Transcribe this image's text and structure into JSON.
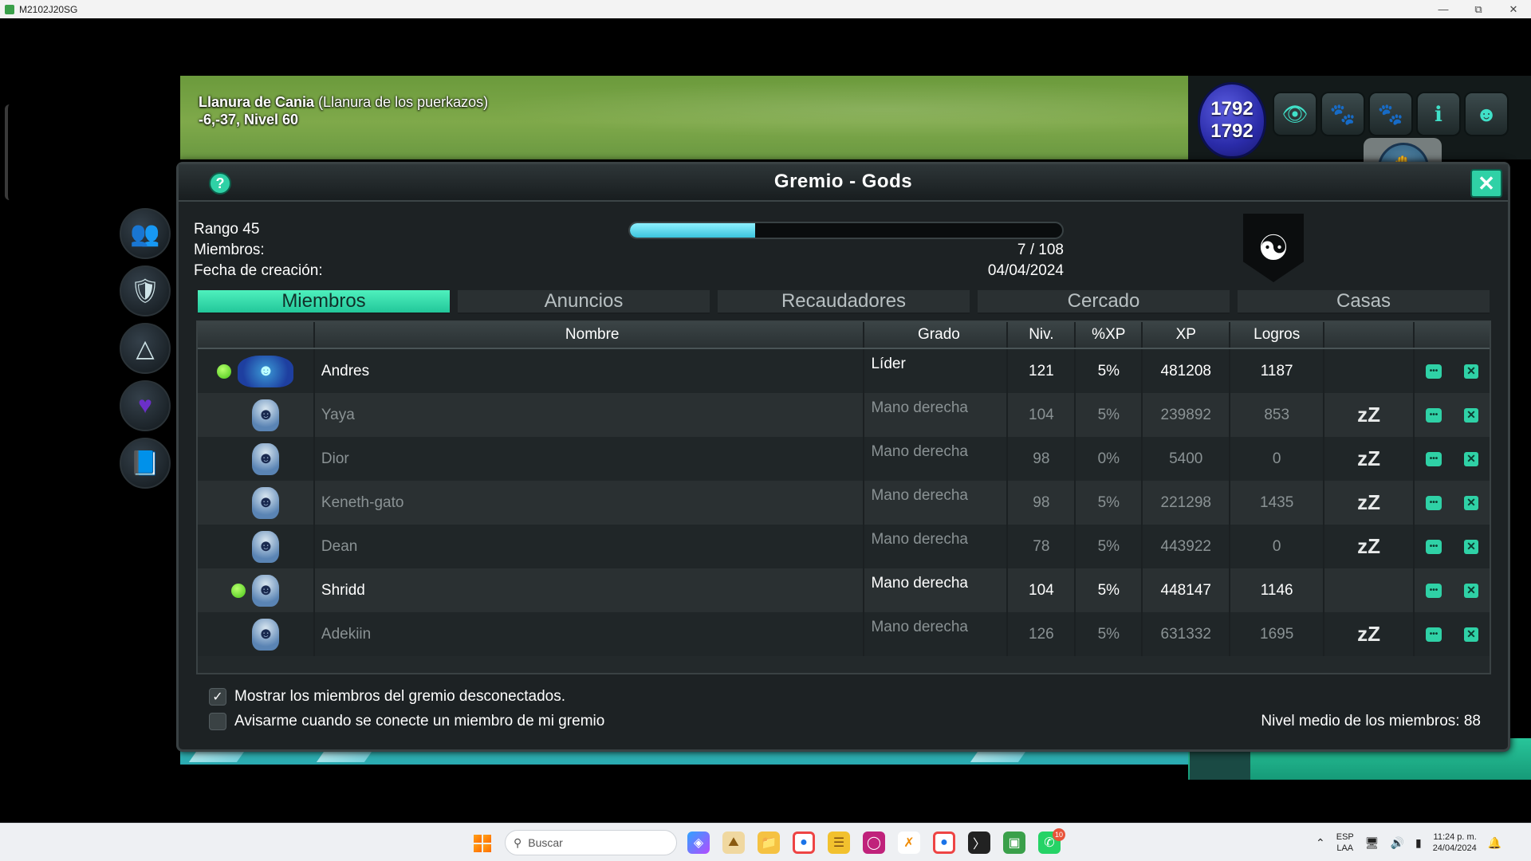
{
  "window": {
    "title": "M2102J20SG"
  },
  "location": {
    "name": "Llanura de Cania",
    "subzone": "(Llanura de los puerkazos)",
    "coords": "-6,-37, Nivel 60"
  },
  "hud": {
    "hp_current": "1792",
    "hp_max": "1792"
  },
  "dialog": {
    "title": "Gremio - Gods",
    "rank_label": "Rango 45",
    "members_label": "Miembros:",
    "members_value": "7 / 108",
    "created_label": "Fecha de creación:",
    "created_value": "04/04/2024",
    "xp_progress": 0.29
  },
  "tabs": [
    "Miembros",
    "Anuncios",
    "Recaudadores",
    "Cercado",
    "Casas"
  ],
  "active_tab": "Miembros",
  "table": {
    "headers": {
      "name": "Nombre",
      "grade": "Grado",
      "level": "Niv.",
      "xp_pct": "%XP",
      "xp": "XP",
      "achievements": "Logros"
    },
    "rows": [
      {
        "name": "Andres",
        "grade": "Líder",
        "level": "121",
        "xp_pct": "5%",
        "xp": "481208",
        "achievements": "1187",
        "online": true,
        "away": ""
      },
      {
        "name": "Yaya",
        "grade": "Mano derecha",
        "level": "104",
        "xp_pct": "5%",
        "xp": "239892",
        "achievements": "853",
        "online": false,
        "away": "zZ"
      },
      {
        "name": "Dior",
        "grade": "Mano derecha",
        "level": "98",
        "xp_pct": "0%",
        "xp": "5400",
        "achievements": "0",
        "online": false,
        "away": "zZ"
      },
      {
        "name": "Keneth-gato",
        "grade": "Mano derecha",
        "level": "98",
        "xp_pct": "5%",
        "xp": "221298",
        "achievements": "1435",
        "online": false,
        "away": "zZ"
      },
      {
        "name": "Dean",
        "grade": "Mano derecha",
        "level": "78",
        "xp_pct": "5%",
        "xp": "443922",
        "achievements": "0",
        "online": false,
        "away": "zZ"
      },
      {
        "name": "Shridd",
        "grade": "Mano derecha",
        "level": "104",
        "xp_pct": "5%",
        "xp": "448147",
        "achievements": "1146",
        "online": true,
        "away": ""
      },
      {
        "name": "Adekiin",
        "grade": "Mano derecha",
        "level": "126",
        "xp_pct": "5%",
        "xp": "631332",
        "achievements": "1695",
        "online": false,
        "away": "zZ"
      }
    ]
  },
  "footer": {
    "show_offline_label": "Mostrar los miembros del gremio desconectados.",
    "show_offline_checked": true,
    "notify_label": "Avisarme cuando se conecte un miembro de mi gremio",
    "notify_checked": false,
    "avg_level": "Nivel medio de los miembros: 88"
  },
  "taskbar": {
    "search_placeholder": "Buscar",
    "lang_line1": "ESP",
    "lang_line2": "LAA",
    "time": "11:24 p. m.",
    "date": "24/04/2024",
    "whatsapp_badge": "10"
  }
}
